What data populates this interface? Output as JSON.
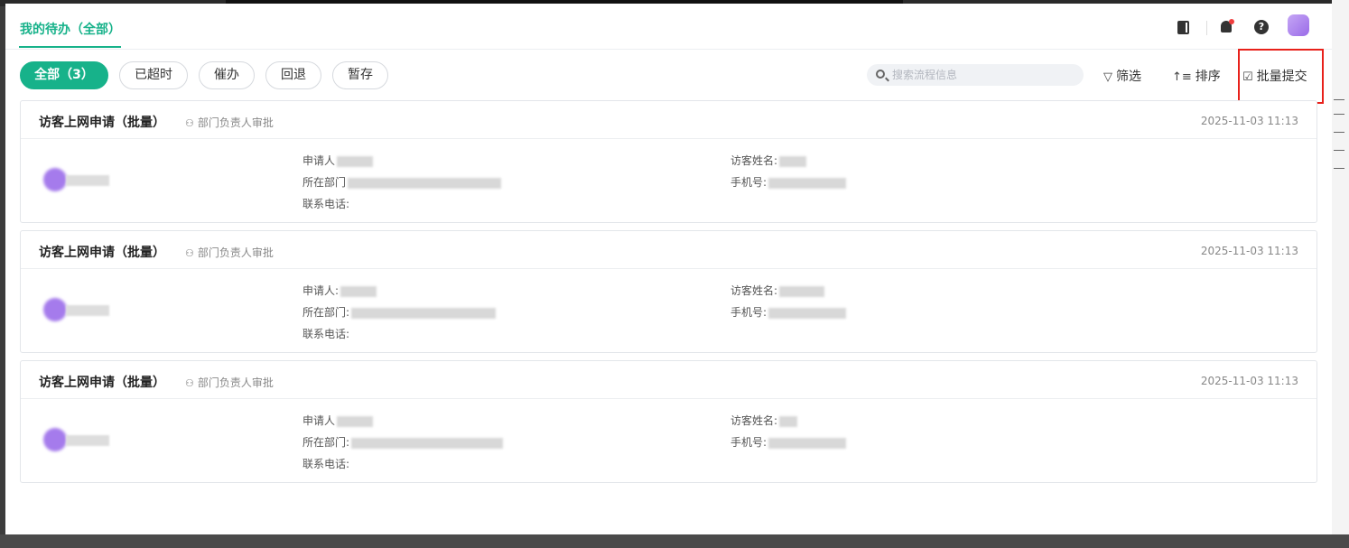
{
  "tab": {
    "label": "我的待办（全部）"
  },
  "header_icons": [
    {
      "name": "book-icon"
    },
    {
      "name": "bell-icon"
    },
    {
      "name": "help-icon",
      "glyph": "?"
    }
  ],
  "filters": [
    {
      "label": "全部（3）",
      "active": true
    },
    {
      "label": "已超时",
      "active": false
    },
    {
      "label": "催办",
      "active": false
    },
    {
      "label": "回退",
      "active": false
    },
    {
      "label": "暂存",
      "active": false
    }
  ],
  "search": {
    "placeholder": "搜索流程信息",
    "value": ""
  },
  "tools": {
    "filter": "筛选",
    "sort": "排序",
    "batch_submit": "批量提交"
  },
  "colors": {
    "accent": "#17b28a",
    "highlight_box": "#e8211b",
    "avatar": "#a57bec"
  },
  "cards": [
    {
      "title": "访客上网申请（批量）",
      "node": "部门负责人审批",
      "time": "2025-11-03 11:13",
      "applicant_label": "申请人",
      "dept_label": "所在部门",
      "phone_label": "联系电话:",
      "visitor_label": "访客姓名:",
      "mobile_label": "手机号:"
    },
    {
      "title": "访客上网申请（批量）",
      "node": "部门负责人审批",
      "time": "2025-11-03 11:13",
      "applicant_label": "申请人:",
      "dept_label": "所在部门:",
      "phone_label": "联系电话:",
      "visitor_label": "访客姓名:",
      "mobile_label": "手机号:"
    },
    {
      "title": "访客上网申请（批量）",
      "node": "部门负责人审批",
      "time": "2025-11-03 11:13",
      "applicant_label": "申请人",
      "dept_label": "所在部门:",
      "phone_label": "联系电话:",
      "visitor_label": "访客姓名:",
      "mobile_label": "手机号:"
    }
  ]
}
